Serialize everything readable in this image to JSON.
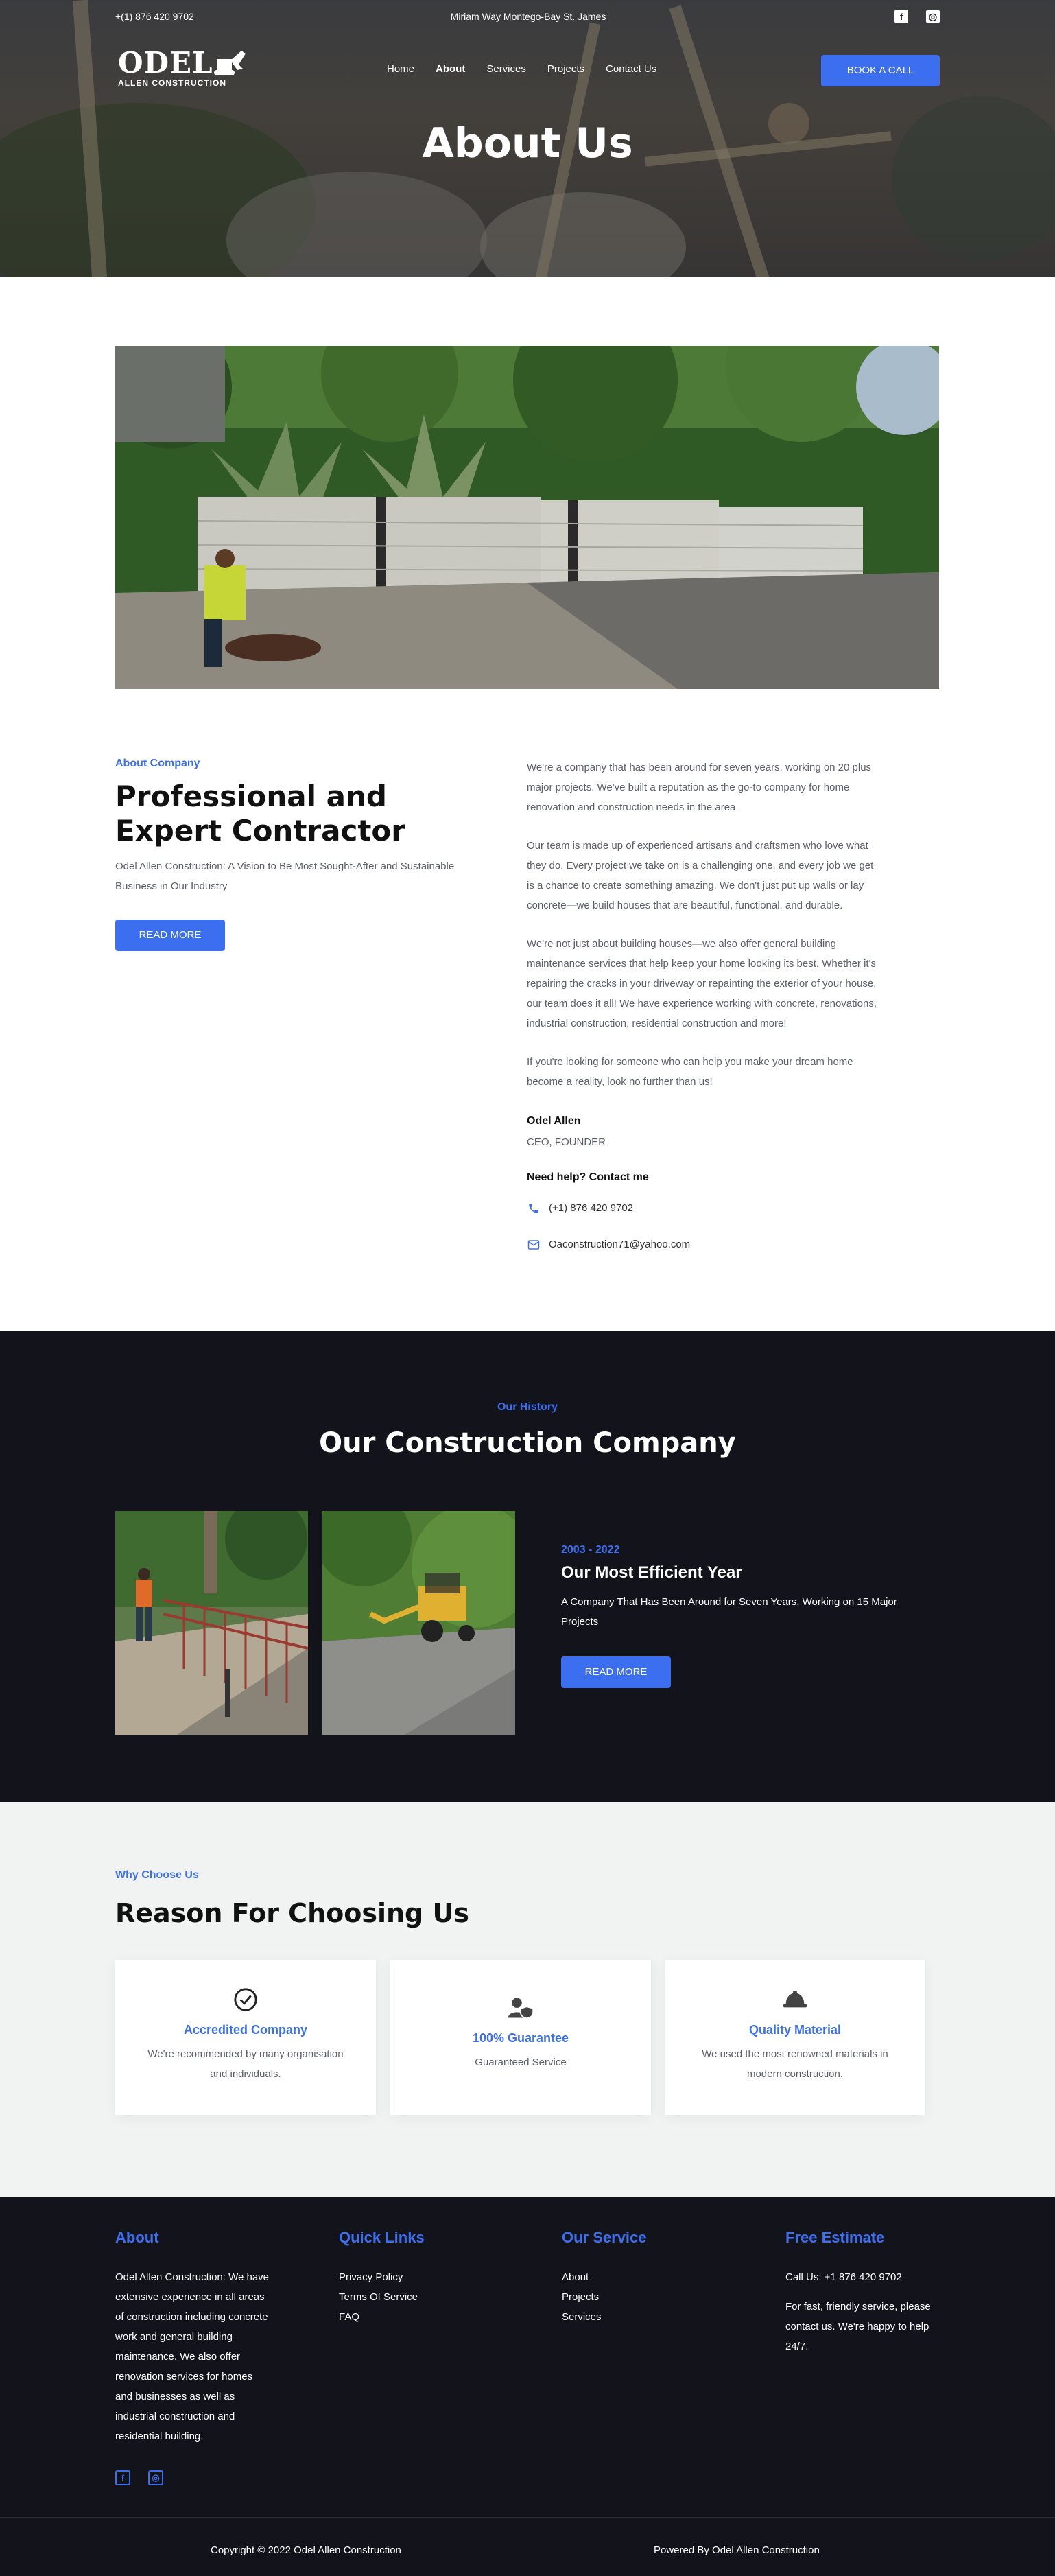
{
  "topbar": {
    "phone": "+(1) 876 420 9702",
    "address": "Miriam Way Montego-Bay St. James",
    "social": [
      {
        "icon": "facebook-icon",
        "glyph": "f"
      },
      {
        "icon": "instagram-icon",
        "glyph": "◎"
      }
    ]
  },
  "logo": {
    "name": "ODEL",
    "sub": "ALLEN CONSTRUCTION"
  },
  "nav": {
    "items": [
      "Home",
      "About",
      "Services",
      "Projects",
      "Contact Us"
    ],
    "active": "About",
    "cta": "BOOK A CALL"
  },
  "hero": {
    "title": "About Us"
  },
  "about": {
    "eyebrow": "About Company",
    "title": "Professional and Expert Contractor",
    "tagline": "Odel Allen Construction: A Vision to Be Most Sought-After and Sustainable Business in Our Industry",
    "button": "READ MORE",
    "paragraphs": [
      "We're a company that has been around for seven years, working on 20 plus major projects. We've built a reputation as the go-to company for home renovation and construction needs in the area.",
      "Our team is made up of experienced artisans and craftsmen who love what they do. Every project we take on is a challenging one, and every job we get is a chance to create something amazing. We don't just put up walls or lay concrete—we build houses that are beautiful, functional, and durable.",
      "We're not just about building houses—we also offer general building maintenance services that help keep your home looking its best. Whether it's repairing the cracks in your driveway or repainting the exterior of your house, our team does it all! We have experience working with concrete, renovations, industrial construction, residential construction and more!",
      "If you're looking for someone who can help you make your dream home become a reality, look no further than us!"
    ],
    "founder_name": "Odel Allen",
    "founder_role": "CEO, FOUNDER",
    "help": "Need help? Contact me",
    "phone": "(+1) 876 420 9702",
    "email": "Oaconstruction71@yahoo.com"
  },
  "history": {
    "eyebrow": "Our History",
    "title": "Our Construction Company",
    "years": "2003 - 2022",
    "heading": "Our Most Efficient Year",
    "text": "A Company That Has Been Around for Seven Years, Working on 15 Major Projects",
    "button": "READ MORE"
  },
  "why": {
    "eyebrow": "Why Choose Us",
    "title": "Reason For Choosing Us",
    "cards": [
      {
        "icon": "check-circle-icon",
        "title": "Accredited Company",
        "text": "We're recommended by many organisation and individuals."
      },
      {
        "icon": "user-shield-icon",
        "title": "100% Guarantee",
        "text": "Guaranteed Service"
      },
      {
        "icon": "hard-hat-icon",
        "title": "Quality Material",
        "text": "We used the most renowned materials in modern construction."
      }
    ]
  },
  "footer": {
    "about_title": "About",
    "about_text": "Odel Allen Construction: We have extensive experience in all areas of construction including concrete work and general building maintenance. We also offer renovation services for homes and businesses as well as industrial construction and residential building.",
    "links_title": "Quick Links",
    "links": [
      "Privacy Policy",
      "Terms Of Service",
      "FAQ"
    ],
    "service_title": "Our Service",
    "services": [
      "About",
      "Projects",
      "Services"
    ],
    "estimate_title": "Free Estimate",
    "call": "Call Us: +1 876 420 9702",
    "estimate_text": "For fast, friendly service, please contact us. We're happy to help 24/7.",
    "copyright": "Copyright © 2022 Odel Allen Construction",
    "powered": "Powered By Odel Allen Construction"
  },
  "colors": {
    "accent": "#3c6ff0",
    "dark": "#13141b",
    "light": "#f1f2f2"
  }
}
